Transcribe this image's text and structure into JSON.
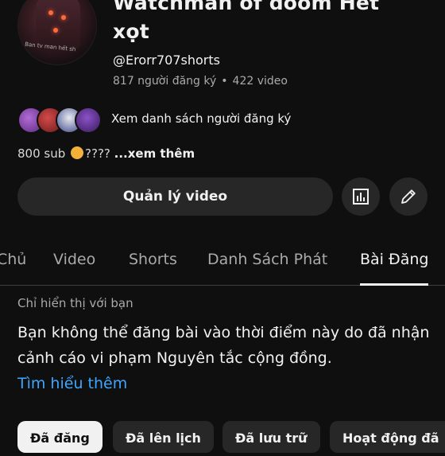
{
  "channel": {
    "title": "Watchman of doom Hết\nxọt",
    "handle": "@Erorr707shorts",
    "subscribers": "817 người đăng ký",
    "videos": "422 video",
    "avatar_text": "Ban tv man hết sh"
  },
  "subscribers_link": "Xem danh sách người đăng ký",
  "bio": {
    "text_before": "800 sub ",
    "text_after": "???? ",
    "more_label": "...xem thêm"
  },
  "actions": {
    "manage_videos": "Quản lý video",
    "analytics_icon": "analytics-icon",
    "edit_icon": "pencil-icon"
  },
  "tabs": [
    {
      "label": "Chủ"
    },
    {
      "label": "Video"
    },
    {
      "label": "Shorts"
    },
    {
      "label": "Danh Sách Phát"
    },
    {
      "label": "Bài Đăng",
      "active": true
    }
  ],
  "notice": {
    "visibility": "Chỉ hiển thị với bạn",
    "message": "Bạn không thể đăng bài vào thời điểm này do đã nhận cảnh cáo vi phạm Nguyên tắc cộng đồng.",
    "learn_more": "Tìm hiểu thêm"
  },
  "filters": [
    {
      "label": "Đã đăng",
      "selected": true
    },
    {
      "label": "Đã lên lịch"
    },
    {
      "label": "Đã lưu trữ"
    },
    {
      "label": "Hoạt động đã"
    }
  ],
  "colors": {
    "background": "#0f0f0f",
    "surface": "#272727",
    "link": "#3ea6ff",
    "muted": "#aaaaaa"
  }
}
